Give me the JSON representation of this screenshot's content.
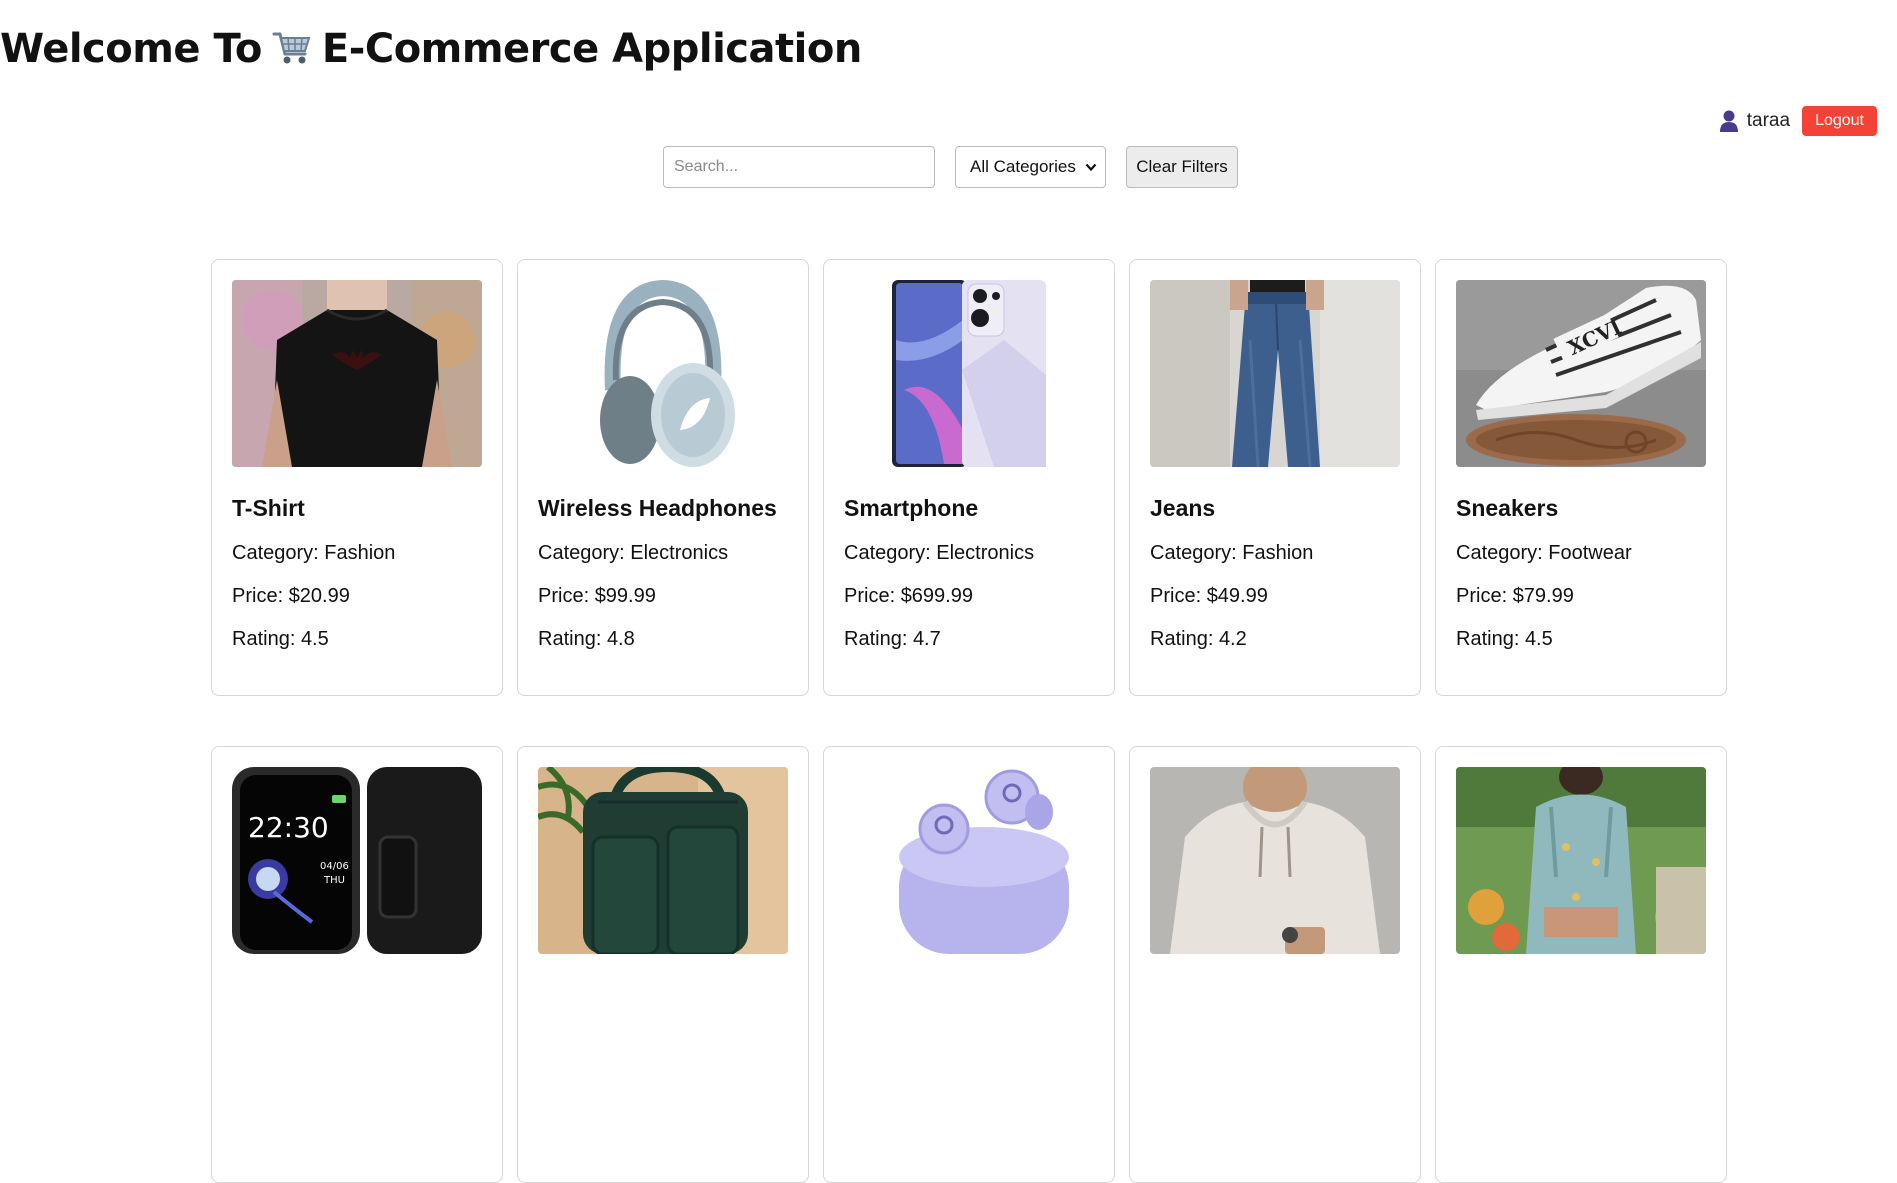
{
  "header": {
    "title_prefix": "Welcome To",
    "title_suffix": "E-Commerce Application",
    "cart_icon": "shopping-cart-icon"
  },
  "user": {
    "icon": "user-icon",
    "name": "taraa",
    "logout_label": "Logout",
    "logout_color": "#f44336"
  },
  "filters": {
    "search_placeholder": "Search...",
    "category_selected": "All Categories",
    "clear_label": "Clear Filters"
  },
  "labels": {
    "category": "Category: ",
    "price": "Price: ",
    "rating": "Rating: "
  },
  "products": [
    {
      "name": "T-Shirt",
      "category": "Fashion",
      "price": "$20.99",
      "rating": "4.5",
      "image": "black-tshirt-photo"
    },
    {
      "name": "Wireless Headphones",
      "category": "Electronics",
      "price": "$99.99",
      "rating": "4.8",
      "image": "headphones-photo"
    },
    {
      "name": "Smartphone",
      "category": "Electronics",
      "price": "$699.99",
      "rating": "4.7",
      "image": "smartphone-photo"
    },
    {
      "name": "Jeans",
      "category": "Fashion",
      "price": "$49.99",
      "rating": "4.2",
      "image": "jeans-photo"
    },
    {
      "name": "Sneakers",
      "category": "Footwear",
      "price": "$79.99",
      "rating": "4.5",
      "image": "sneakers-photo"
    },
    {
      "image": "smartwatch-photo"
    },
    {
      "image": "backpack-photo"
    },
    {
      "image": "earbuds-photo"
    },
    {
      "image": "hoodie-photo"
    },
    {
      "image": "kurta-photo"
    }
  ]
}
